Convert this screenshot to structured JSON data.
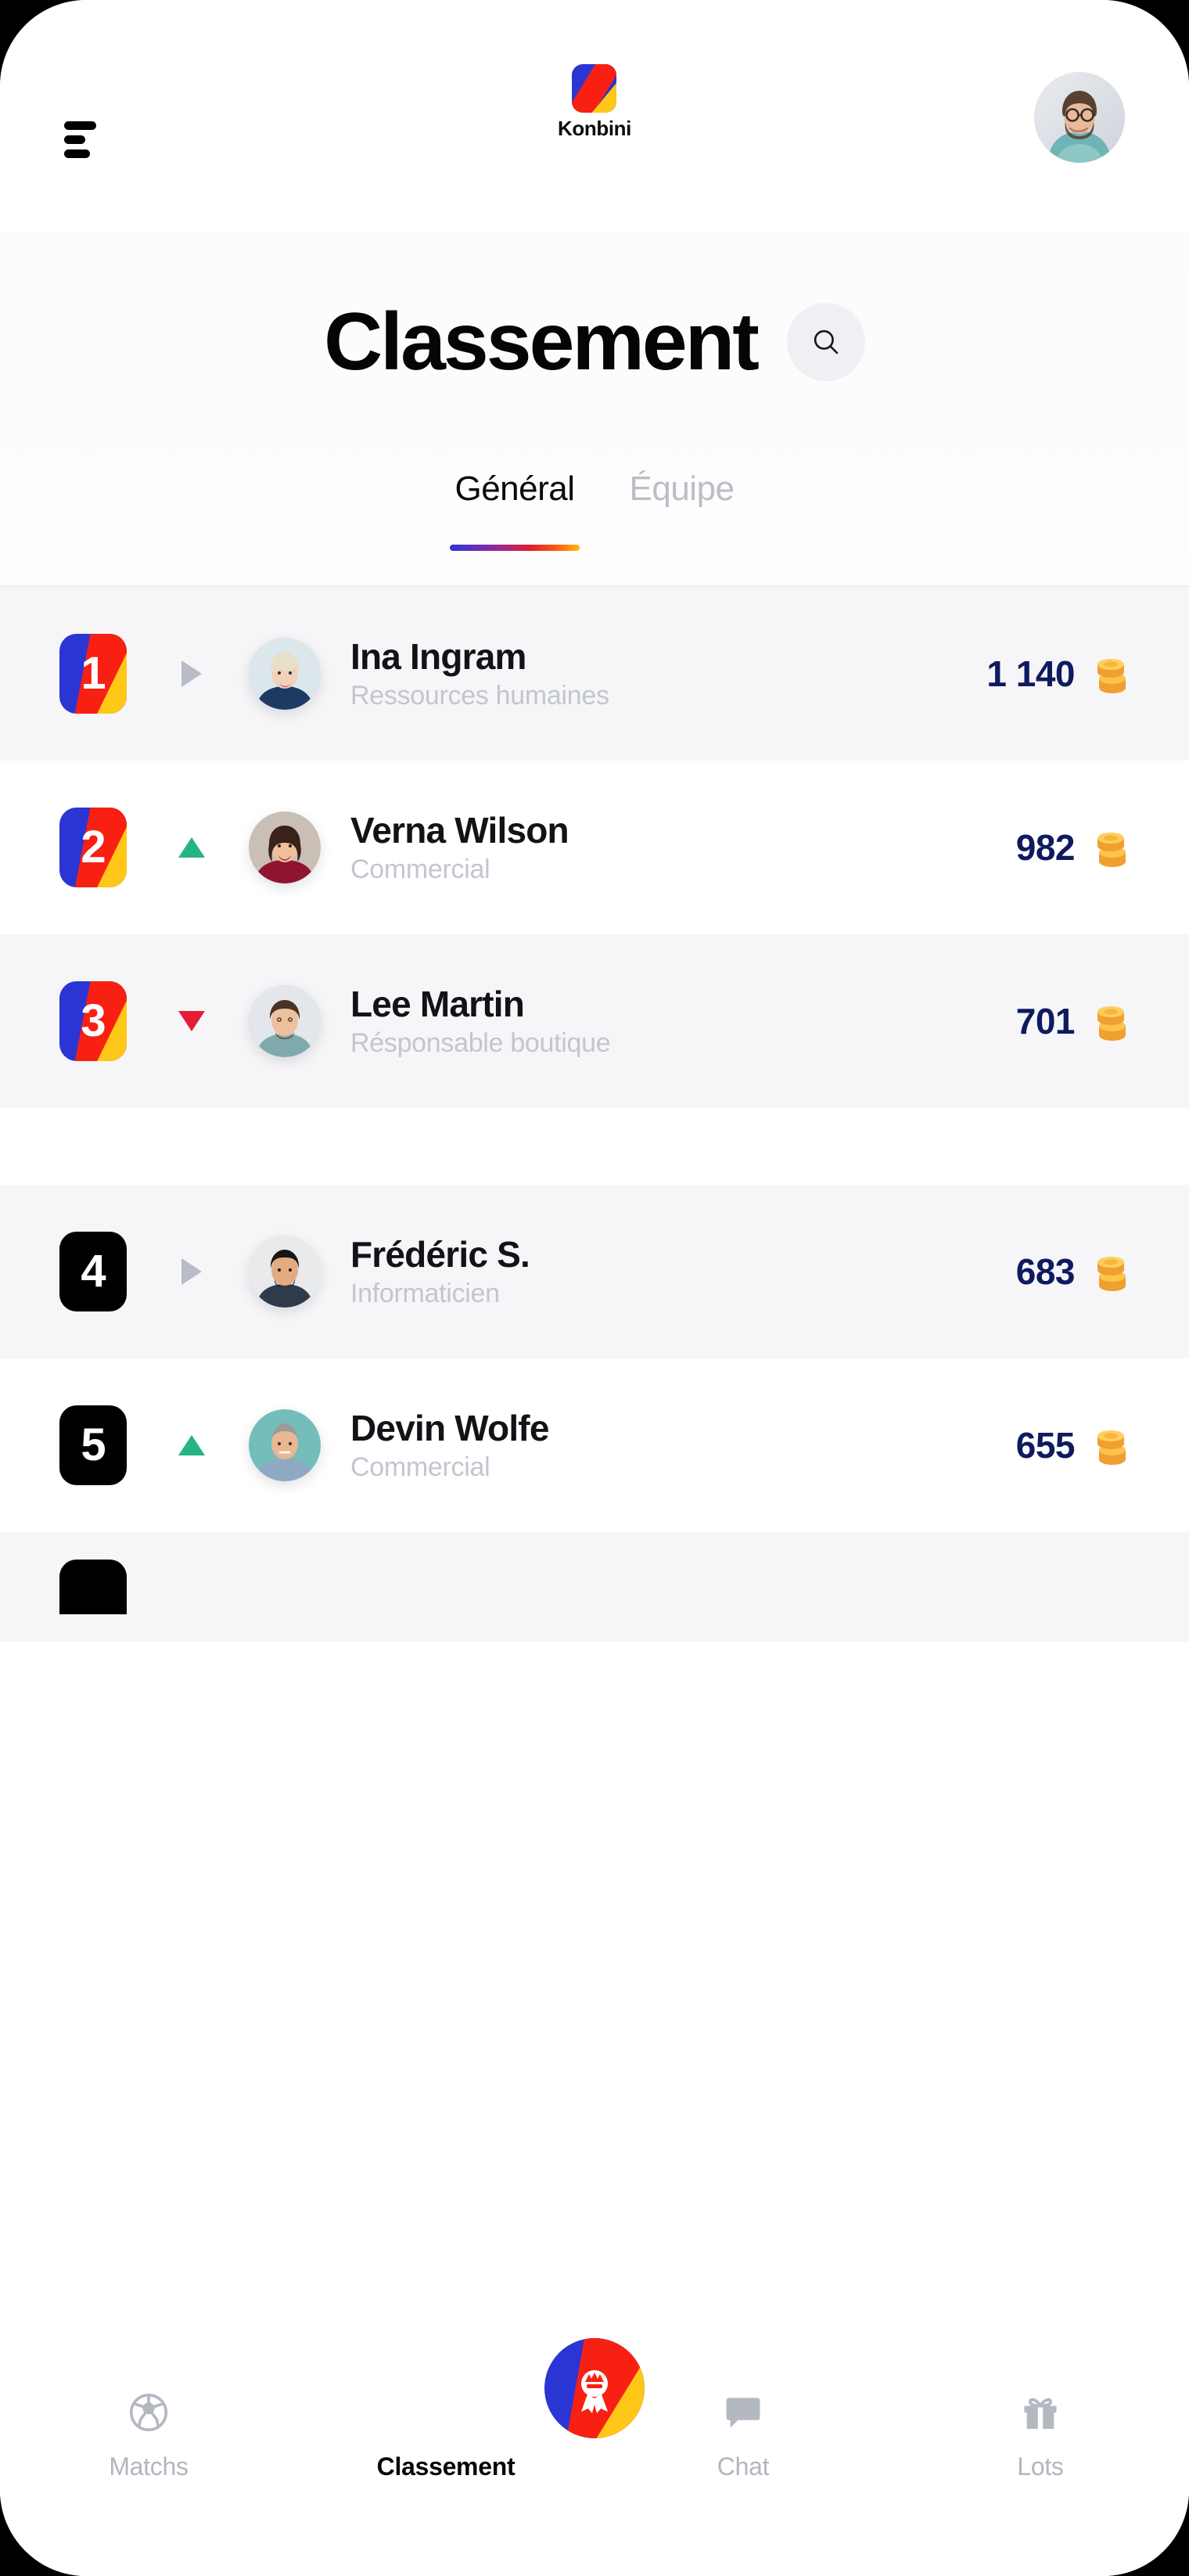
{
  "header": {
    "menu_icon": "hamburger-icon",
    "brand_name": "Konbini",
    "brand_logo": "konbini-logo",
    "avatar": "user-avatar"
  },
  "page": {
    "title": "Classement",
    "search_icon": "search-icon"
  },
  "tabs": [
    {
      "label": "Général",
      "active": true
    },
    {
      "label": "Équipe",
      "active": false
    }
  ],
  "leaderboard": {
    "rows": [
      {
        "rank": "1",
        "name": "Ina Ingram",
        "role": "Ressources humaines",
        "score": "1 140",
        "trend": "same",
        "badge": "konbini",
        "shaded": true,
        "coin": "coins-icon"
      },
      {
        "rank": "2",
        "name": "Verna Wilson",
        "role": "Commercial",
        "score": "982",
        "trend": "up",
        "badge": "konbini",
        "shaded": false,
        "coin": "coins-icon"
      },
      {
        "rank": "3",
        "name": "Lee Martin",
        "role": "Résponsable boutique",
        "score": "701",
        "trend": "down",
        "badge": "konbini",
        "shaded": true,
        "coin": "coins-icon"
      },
      {
        "rank": "4",
        "name": "Frédéric S.",
        "role": "Informaticien",
        "score": "683",
        "trend": "same",
        "badge": "dark",
        "shaded": true,
        "coin": "coins-icon"
      },
      {
        "rank": "5",
        "name": "Devin Wolfe",
        "role": "Commercial",
        "score": "655",
        "trend": "up",
        "badge": "dark",
        "shaded": false,
        "coin": "coins-icon"
      }
    ]
  },
  "tabbar": {
    "items": [
      {
        "label": "Matchs",
        "icon": "soccer-ball-icon",
        "active": false
      },
      {
        "label": "Classement",
        "icon": "award-medal-icon",
        "active": true
      },
      {
        "label": "Chat",
        "icon": "speech-bubble-icon",
        "active": false
      },
      {
        "label": "Lots",
        "icon": "gift-icon",
        "active": false
      }
    ]
  },
  "colors": {
    "brand_blue": "#2b35d4",
    "brand_red": "#f72013",
    "brand_yellow": "#ffc717",
    "score_navy": "#0f1b5e",
    "trend_up": "#25b487",
    "trend_down": "#e71d36",
    "trend_same": "#b7bcc6"
  }
}
